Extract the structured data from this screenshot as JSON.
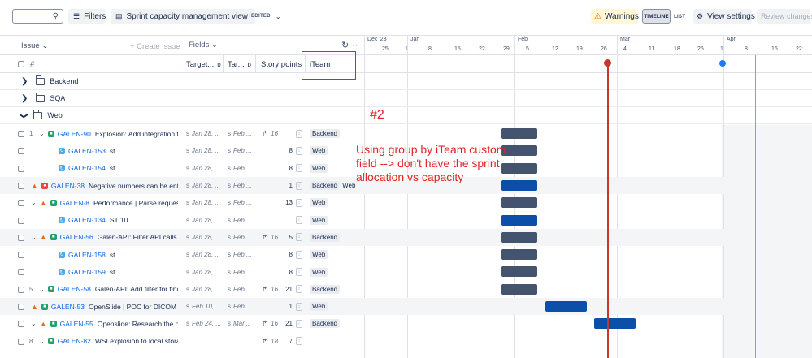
{
  "toolbar": {
    "search_placeholder": "",
    "filters_label": "Filters",
    "view_label": "Sprint capacity management view",
    "view_badge": "EDITED",
    "warnings_label": "Warnings",
    "timeline_label": "TIMELINE",
    "list_label": "LIST",
    "view_settings_label": "View settings",
    "review_label": "Review changes"
  },
  "header": {
    "issue_label": "Issue",
    "create_issue_label": "+ Create issue",
    "fields_label": "Fields",
    "hash_label": "#",
    "col_target_start": "Target...",
    "col_target_end": "Tar...",
    "col_story_points": "Story points",
    "col_iteam": "iTeam",
    "sort_badge": "D"
  },
  "timeline": {
    "months": [
      {
        "label": "Dec '23"
      },
      {
        "label": "Jan"
      },
      {
        "label": "Feb"
      },
      {
        "label": "Mar"
      },
      {
        "label": "Apr"
      }
    ],
    "days": [
      "25",
      "1",
      "8",
      "15",
      "22",
      "29",
      "5",
      "12",
      "19",
      "26",
      "4",
      "11",
      "18",
      "25",
      "1",
      "8",
      "15",
      "22"
    ]
  },
  "groups": {
    "backend": "Backend",
    "sqa": "SQA",
    "web": "Web"
  },
  "rows": [
    {
      "num": "1",
      "expand": true,
      "prio": false,
      "type": "story",
      "key": "GALEN-90",
      "summary": "Explosion: Add integration te...",
      "start": "Jan 28, ...",
      "end": "Feb ...",
      "arrow": true,
      "sp": "16",
      "spin": "",
      "team": "Backend",
      "team2": ""
    },
    {
      "num": "",
      "expand": false,
      "prio": false,
      "type": "subtask",
      "key": "GALEN-153",
      "summary": "st",
      "start": "Jan 28, ...",
      "end": "Feb ...",
      "arrow": false,
      "sp": "",
      "spin": "8",
      "team": "Web",
      "team2": ""
    },
    {
      "num": "",
      "expand": false,
      "prio": false,
      "type": "subtask",
      "key": "GALEN-154",
      "summary": "st",
      "start": "Jan 28, ...",
      "end": "Feb ...",
      "arrow": false,
      "sp": "",
      "spin": "8",
      "team": "Web",
      "team2": ""
    },
    {
      "num": "",
      "expand": false,
      "prio": true,
      "type": "bug",
      "key": "GALEN-38",
      "summary": "Negative numbers can be ent...",
      "start": "Jan 28, ...",
      "end": "Feb ...",
      "arrow": false,
      "sp": "",
      "spin": "1",
      "team": "Backend",
      "team2": "Web"
    },
    {
      "num": "",
      "expand": true,
      "prio": true,
      "type": "story",
      "key": "GALEN-8",
      "summary": "Performance | Parse requests ...",
      "start": "Jan 28, ...",
      "end": "Feb ...",
      "arrow": false,
      "sp": "",
      "spin": "13",
      "team": "Web",
      "team2": ""
    },
    {
      "num": "",
      "expand": false,
      "prio": false,
      "type": "subtask",
      "key": "GALEN-134",
      "summary": "ST 10",
      "start": "Jan 28, ...",
      "end": "Feb ...",
      "arrow": false,
      "sp": "",
      "spin": "",
      "team": "Web",
      "team2": ""
    },
    {
      "num": "",
      "expand": true,
      "prio": true,
      "type": "story",
      "key": "GALEN-56",
      "summary": "Galen-API: Filter API calls bas...",
      "start": "Jan 28, ...",
      "end": "Feb ...",
      "arrow": true,
      "sp": "16",
      "spin": "5",
      "team": "Backend",
      "team2": ""
    },
    {
      "num": "",
      "expand": false,
      "prio": false,
      "type": "subtask",
      "key": "GALEN-158",
      "summary": "st",
      "start": "Jan 28, ...",
      "end": "Feb ...",
      "arrow": false,
      "sp": "",
      "spin": "8",
      "team": "Web",
      "team2": ""
    },
    {
      "num": "",
      "expand": false,
      "prio": false,
      "type": "subtask",
      "key": "GALEN-159",
      "summary": "st",
      "start": "Jan 28, ...",
      "end": "Feb ...",
      "arrow": false,
      "sp": "",
      "spin": "8",
      "team": "Web",
      "team2": ""
    },
    {
      "num": "5",
      "expand": true,
      "prio": false,
      "type": "story",
      "key": "GALEN-58",
      "summary": "Galen-API: Add filter for findi...",
      "start": "Jan 28, ...",
      "end": "Feb ...",
      "arrow": true,
      "sp": "16",
      "spin": "21",
      "team": "Backend",
      "team2": ""
    },
    {
      "num": "",
      "expand": false,
      "prio": true,
      "type": "story",
      "key": "GALEN-53",
      "summary": "OpenSlide | POC for DICOM",
      "start": "Feb 10, ...",
      "end": "Feb ...",
      "arrow": false,
      "sp": "",
      "spin": "1",
      "team": "Web",
      "team2": ""
    },
    {
      "num": "",
      "expand": true,
      "prio": true,
      "type": "story",
      "key": "GALEN-55",
      "summary": "Openslide: Research the publ...",
      "start": "Feb 24, ...",
      "end": "Mar...",
      "arrow": true,
      "sp": "16",
      "spin": "21",
      "team": "Backend",
      "team2": ""
    },
    {
      "num": "8",
      "expand": true,
      "prio": false,
      "type": "story",
      "key": "GALEN-82",
      "summary": "WSI explosion to local storage",
      "start": "",
      "end": "",
      "arrow": true,
      "sp": "18",
      "spin": "7",
      "team": "",
      "team2": ""
    }
  ],
  "annotation": {
    "number": "#2",
    "text": "Using group by iTeam custom field --> don't have the sprint allocation vs capacity"
  }
}
